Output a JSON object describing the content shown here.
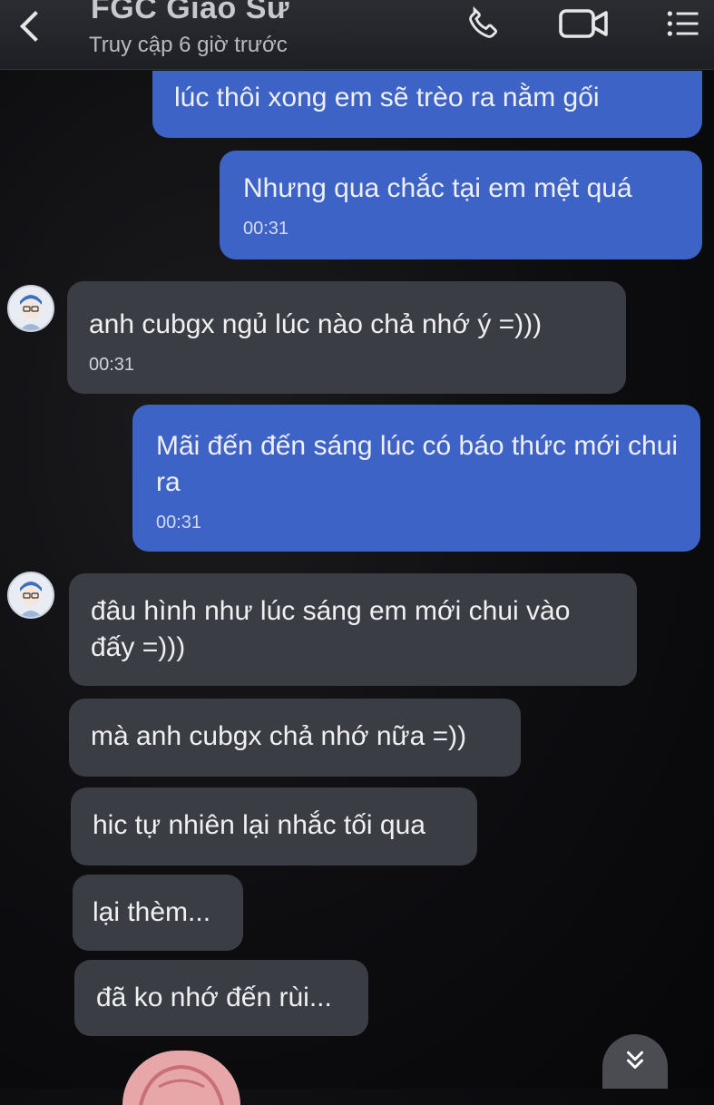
{
  "header": {
    "title": "FGC Giáo Sư",
    "status": "Truy cập 6 giờ trước",
    "icons": {
      "back": "back-icon",
      "call": "phone-icon",
      "video": "video-call-icon",
      "menu": "menu-list-icon"
    }
  },
  "messages": [
    {
      "side": "sent",
      "text": "lúc thôi xong em sẽ trèo ra nằm gối",
      "time": ""
    },
    {
      "side": "sent",
      "text": "Nhưng qua chắc tại em mệt quá",
      "time": "00:31"
    },
    {
      "side": "recv",
      "text": "anh cubgx ngủ lúc nào chả nhớ ý =)))",
      "time": "00:31"
    },
    {
      "side": "sent",
      "text": "Mãi đến đến sáng lúc có báo thức mới chui ra",
      "time": "00:31"
    },
    {
      "side": "recv",
      "text": "đâu hình như lúc sáng em mới chui vào đấy =)))",
      "time": ""
    },
    {
      "side": "recv",
      "text": "mà anh cubgx chả nhớ nữa =))",
      "time": ""
    },
    {
      "side": "recv",
      "text": "hic tự nhiên lại nhắc tối qua",
      "time": ""
    },
    {
      "side": "recv",
      "text": "lại thèm...",
      "time": ""
    },
    {
      "side": "recv",
      "text": "đã ko nhớ đến rùi...",
      "time": ""
    }
  ],
  "colors": {
    "sent_bubble": "#3e63c6",
    "recv_bubble": "#3b3d45",
    "header": "#2b2d33"
  }
}
